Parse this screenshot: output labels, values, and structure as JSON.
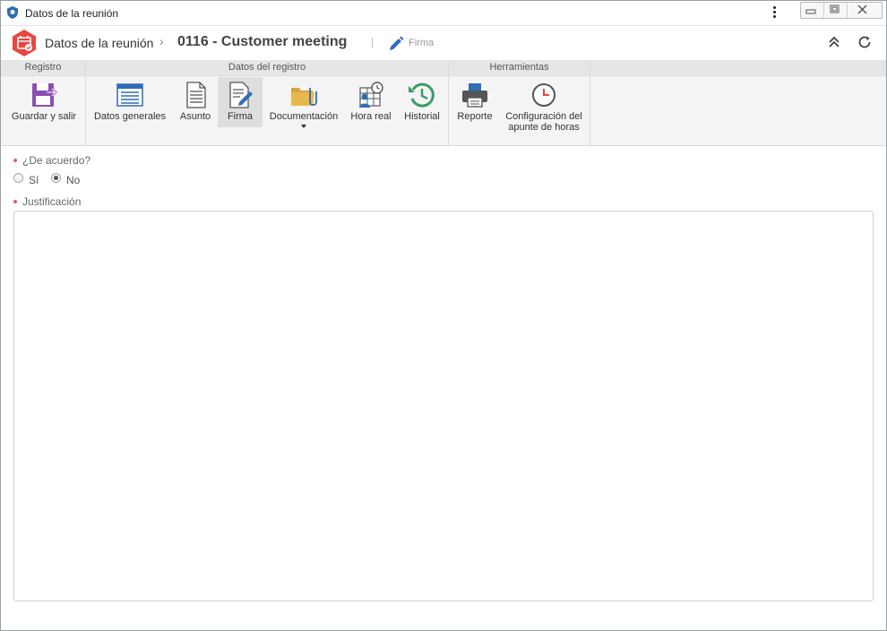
{
  "window": {
    "title": "Datos de la reunión"
  },
  "header": {
    "breadcrumb_parent": "Datos de la reunión",
    "breadcrumb_separator": "›",
    "record_title": "0116 - Customer meeting",
    "current_section": "Firma"
  },
  "ribbon": {
    "groups": [
      {
        "title": "Registro",
        "buttons": [
          {
            "label": "Guardar y salir",
            "icon": "save-exit-icon"
          }
        ]
      },
      {
        "title": "Datos del registro",
        "buttons": [
          {
            "label": "Datos generales",
            "icon": "form-icon"
          },
          {
            "label": "Asunto",
            "icon": "document-icon"
          },
          {
            "label": "Firma",
            "icon": "signature-icon",
            "active": true
          },
          {
            "label": "Documentación",
            "icon": "folder-clip-icon",
            "dropdown": true
          },
          {
            "label": "Hora real",
            "icon": "schedule-person-icon"
          },
          {
            "label": "Historial",
            "icon": "history-icon"
          }
        ]
      },
      {
        "title": "Herramientas",
        "buttons": [
          {
            "label": "Reporte",
            "icon": "printer-icon"
          },
          {
            "label": "Configuración del",
            "label2": "apunte de horas",
            "icon": "clock-icon"
          }
        ]
      }
    ]
  },
  "form": {
    "agreement_label": "¿De acuerdo?",
    "option_yes": "Sí",
    "option_no": "No",
    "selected": "No",
    "justification_label": "Justificación",
    "justification_value": ""
  },
  "colors": {
    "logo": "#e8473f",
    "accent_blue": "#2f6db5",
    "purple": "#8a4fb3",
    "green": "#3c9a6c",
    "required": "#e35d5d"
  }
}
